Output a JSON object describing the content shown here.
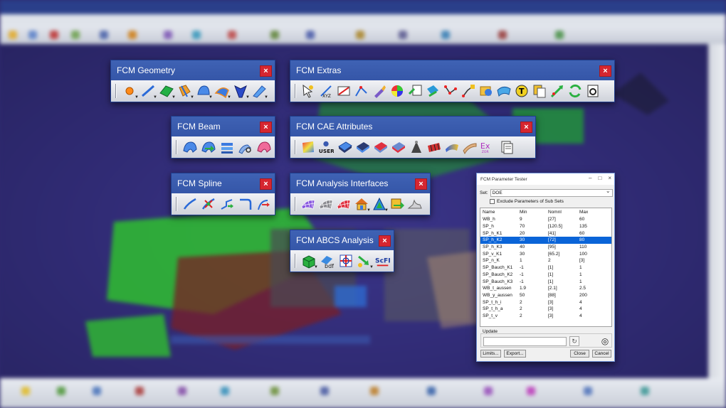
{
  "toolbars": [
    {
      "title": "FCM Geometry",
      "close": "×",
      "icons": [
        "point-icon",
        "line-icon",
        "surface-icon",
        "plane-icon",
        "tube-icon",
        "mesh-surface-icon",
        "profile-icon",
        "spline-surface-icon"
      ]
    },
    {
      "title": "FCM Extras",
      "close": "×",
      "icons": [
        "cursor-icon",
        "xyz-icon",
        "dimension-icon",
        "measure-icon",
        "brush-icon",
        "color-wheel-icon",
        "table-icon",
        "transform-icon",
        "node-connect-icon",
        "node-select-icon",
        "material-icon",
        "merge-icon",
        "t-circle-icon",
        "copy-icon",
        "arrow-edit-icon",
        "refresh-icon",
        "calculator-icon"
      ]
    },
    {
      "title": "FCM Beam",
      "close": "×",
      "icons": [
        "beam-icon",
        "beam-green-icon",
        "beam-section-icon",
        "beam-scissors-icon",
        "beam-pink-icon"
      ]
    },
    {
      "title": "FCM CAE Attributes",
      "close": "×",
      "user_text": "USER",
      "ex_text": "Ex",
      "ex_sub": "ZOR",
      "icons": [
        "gradient-plane-icon",
        "user-icon",
        "thickness-icon",
        "thickness-dark-icon",
        "thickness-red-icon",
        "thickness-red2-icon",
        "mass-icon",
        "pattern-icon",
        "gradient-surface-icon",
        "panel-icon",
        "export-icon",
        "document-icon"
      ]
    },
    {
      "title": "FCM Spline",
      "close": "×",
      "icons": [
        "spline-icon",
        "spline-node-icon",
        "spline-arrow-icon",
        "spline-bend-icon",
        "spline-fork-icon"
      ]
    },
    {
      "title": "FCM Analysis Interfaces",
      "close": "×",
      "icons": [
        "mesh-purple-icon",
        "mesh-grey-icon",
        "mesh-red-icon",
        "house-icon",
        "triangle-icon",
        "export-green-icon",
        "surface-grey-icon"
      ]
    },
    {
      "title": "FCM ABCS Analysis",
      "close": "×",
      "bdf_text": "bdf",
      "scfi_text": "ScFI",
      "icons": [
        "cube-grid-icon",
        "bdf-icon",
        "axis-grid-icon",
        "arrow-down-icon",
        "scfi-icon"
      ]
    }
  ],
  "dialog": {
    "title": "FCM Parameter Tester",
    "window_buttons": [
      "–",
      "□",
      "×"
    ],
    "set_label": "Set:",
    "set_value": "DOE",
    "exclude_label": "Exclude Parameters of Sub Sets",
    "columns": [
      "Name",
      "Min",
      "Nomnl",
      "Max"
    ],
    "rows": [
      [
        "WB_h",
        "9",
        "[27]",
        "60"
      ],
      [
        "SP_h",
        "70",
        "[120.5]",
        "135"
      ],
      [
        "SP_h_K1",
        "20",
        "[41]",
        "60"
      ],
      [
        "SP_h_K2",
        "30",
        "[72]",
        "80"
      ],
      [
        "SP_h_K3",
        "40",
        "[95]",
        "110"
      ],
      [
        "SP_v_K1",
        "30",
        "[65.2]",
        "100"
      ],
      [
        "SP_n_K",
        "1",
        "2",
        "[3]"
      ],
      [
        "SP_Bauch_K1",
        "-1",
        "[1]",
        "1"
      ],
      [
        "SP_Bauch_K2",
        "-1",
        "[1]",
        "1"
      ],
      [
        "SP_Bauch_K3",
        "-1",
        "[1]",
        "1"
      ],
      [
        "WB_t_aussen",
        "1.9",
        "[2.1]",
        "2.5"
      ],
      [
        "WB_y_aussen",
        "50",
        "[88]",
        "200"
      ],
      [
        "SP_t_h_i",
        "2",
        "[3]",
        "4"
      ],
      [
        "SP_t_h_a",
        "2",
        "[3]",
        "4"
      ],
      [
        "SP_t_v",
        "2",
        "[3]",
        "4"
      ]
    ],
    "selected_row": 3,
    "update_label": "Update",
    "buttons": {
      "limits": "Limits...",
      "export": "Export...",
      "close": "Close",
      "cancel": "Cancel"
    }
  },
  "colors": {
    "toolbar_header": "#3a5cae",
    "close_button": "#d62630",
    "selection": "#0a64d8",
    "viewport": "#2f2a6e"
  }
}
